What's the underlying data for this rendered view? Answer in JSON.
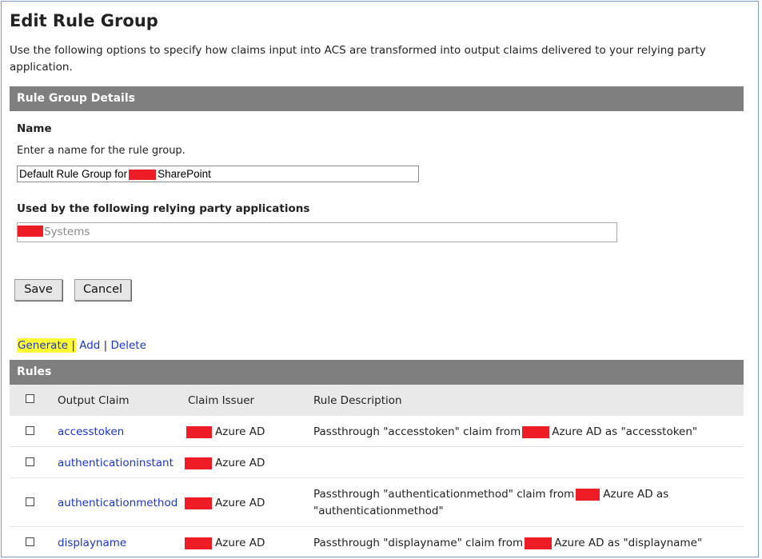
{
  "page": {
    "title": "Edit Rule Group",
    "intro": "Use the following options to specify how claims input into ACS are transformed into output claims delivered to your relying party application."
  },
  "details": {
    "section_title": "Rule Group Details",
    "name_label": "Name",
    "name_hint": "Enter a name for the rule group.",
    "name_value_prefix": "Default Rule Group for",
    "name_value_suffix": "SharePoint",
    "used_by_label": "Used by the following relying party applications",
    "used_by_value": "Systems"
  },
  "buttons": {
    "save": "Save",
    "cancel": "Cancel"
  },
  "actions": {
    "generate": "Generate",
    "add": "Add",
    "delete": "Delete",
    "separator": "|"
  },
  "rules": {
    "section_title": "Rules",
    "columns": [
      "Output Claim",
      "Claim Issuer",
      "Rule Description"
    ],
    "rows": [
      {
        "claim": "accesstoken",
        "issuer": "Azure AD",
        "desc_pre": "Passthrough \"accesstoken\" claim from",
        "desc_post": "Azure AD as \"accesstoken\"",
        "desc_line2": ""
      },
      {
        "claim": "authenticationinstant",
        "issuer": "Azure AD",
        "desc_pre": "",
        "desc_post": "",
        "desc_line2": ""
      },
      {
        "claim": "authenticationmethod",
        "issuer": "Azure AD",
        "desc_pre": "Passthrough \"authenticationmethod\" claim from",
        "desc_post": "Azure AD as",
        "desc_line2": "\"authenticationmethod\""
      },
      {
        "claim": "displayname",
        "issuer": "Azure AD",
        "desc_pre": "Passthrough \"displayname\" claim from",
        "desc_post": "Azure AD as \"displayname\"",
        "desc_line2": ""
      }
    ]
  },
  "colors": {
    "link": "#1a35c7",
    "section_bar": "#7f7f7f",
    "highlight": "#ffff33",
    "redaction": "#ee1c24"
  }
}
